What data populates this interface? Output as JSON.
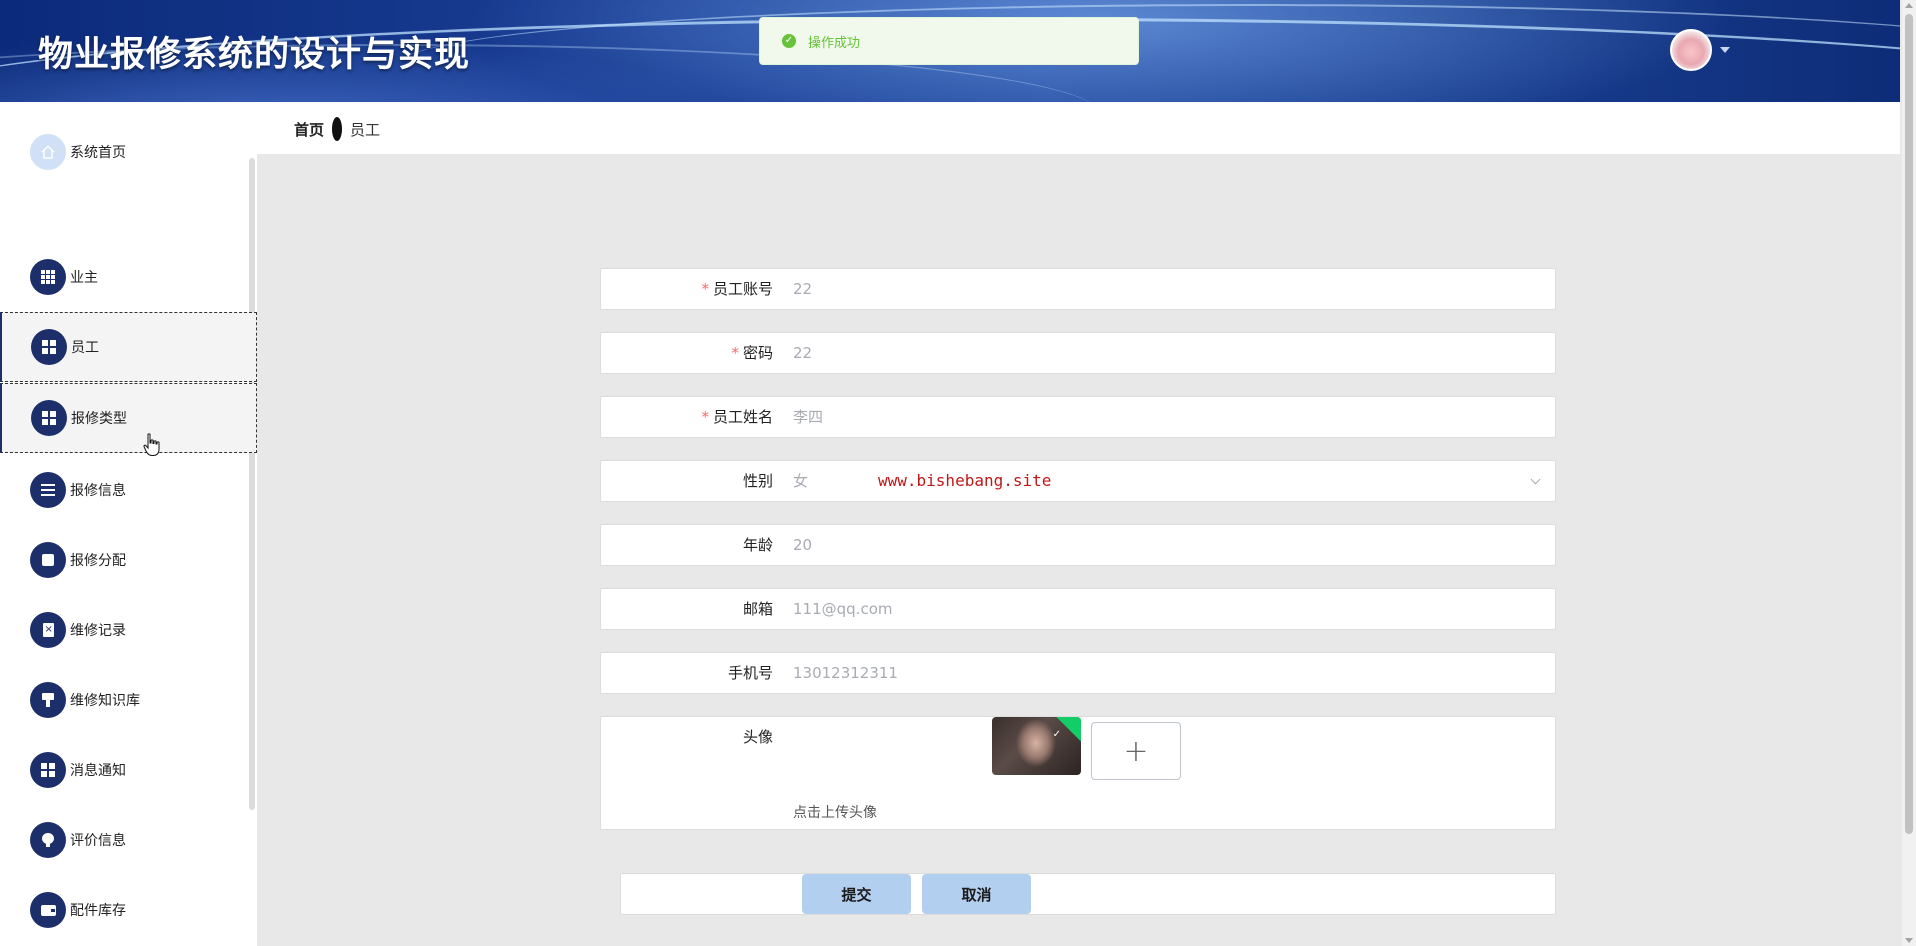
{
  "header": {
    "title": "物业报修系统的设计与实现",
    "avatar_icon": "user-avatar"
  },
  "toast": {
    "text": "操作成功",
    "icon": "success-check-icon",
    "color": "#67c23a"
  },
  "breadcrumb": {
    "home": "首页",
    "current": "员工"
  },
  "sidebar": {
    "accent_color": "#1c2f6b",
    "items": [
      {
        "label": "系统首页",
        "icon": "home-icon"
      },
      {
        "label": "业主",
        "icon": "grid-icon"
      },
      {
        "label": "员工",
        "icon": "grid-icon",
        "active": true
      },
      {
        "label": "报修类型",
        "icon": "grid-icon",
        "active": true
      },
      {
        "label": "报修信息",
        "icon": "list-icon"
      },
      {
        "label": "报修分配",
        "icon": "box-icon"
      },
      {
        "label": "维修记录",
        "icon": "clipboard-icon"
      },
      {
        "label": "维修知识库",
        "icon": "brush-icon"
      },
      {
        "label": "消息通知",
        "icon": "grid-icon"
      },
      {
        "label": "评价信息",
        "icon": "bulb-icon"
      },
      {
        "label": "配件库存",
        "icon": "wallet-icon"
      }
    ]
  },
  "form": {
    "account": {
      "label": "员工账号",
      "required": true,
      "value": "22"
    },
    "password": {
      "label": "密码",
      "required": true,
      "value": "22"
    },
    "name": {
      "label": "员工姓名",
      "required": true,
      "value": "李四"
    },
    "gender": {
      "label": "性别",
      "value": "女"
    },
    "age": {
      "label": "年龄",
      "value": "20"
    },
    "email": {
      "label": "邮箱",
      "value": "111@qq.com"
    },
    "phone": {
      "label": "手机号",
      "value": "13012312311"
    },
    "avatar": {
      "label": "头像",
      "tip": "点击上传头像",
      "add_symbol": "+"
    }
  },
  "watermark": "www.bishebang.site",
  "buttons": {
    "submit": "提交",
    "cancel": "取消"
  }
}
